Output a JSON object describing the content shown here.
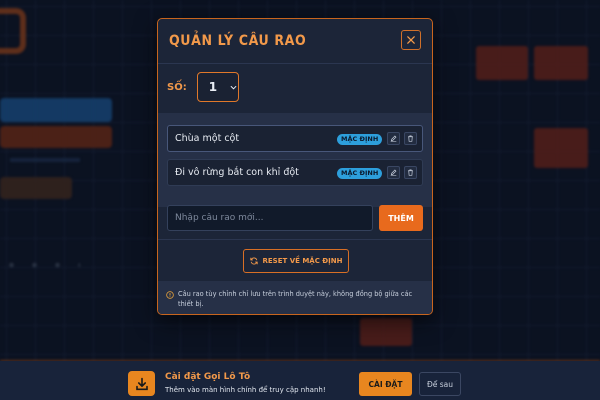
{
  "modal": {
    "title": "QUẢN LÝ CÂU RAO",
    "so_label": "SỐ:",
    "so_value": "1",
    "phrases": [
      {
        "text": "Chùa một cột",
        "badge": "MẶC ĐỊNH"
      },
      {
        "text": "Đi vô rừng bắt con khỉ đột",
        "badge": "MẶC ĐỊNH"
      }
    ],
    "input_placeholder": "Nhập câu rao mới...",
    "add_label": "THÊM",
    "reset_label": "RESET VỀ MẶC ĐỊNH",
    "note": "Câu rao tùy chỉnh chỉ lưu trên trình duyệt này, không đồng bộ giữa các thiết bị."
  },
  "install_bar": {
    "title": "Cài đặt Gọi Lô Tô",
    "subtitle": "Thêm vào màn hình chính để truy cập nhanh!",
    "install_label": "CÀI ĐẶT",
    "later_label": "Để sau"
  },
  "colors": {
    "accent": "#e86a1d",
    "title": "#f2994a",
    "badge": "#2d9fdc",
    "modal_bg": "#1c2538",
    "page_bg": "#0e1728"
  },
  "icons": [
    "close-icon",
    "chevron-down-icon",
    "edit-icon",
    "trash-icon",
    "refresh-icon",
    "info-icon",
    "download-icon"
  ]
}
